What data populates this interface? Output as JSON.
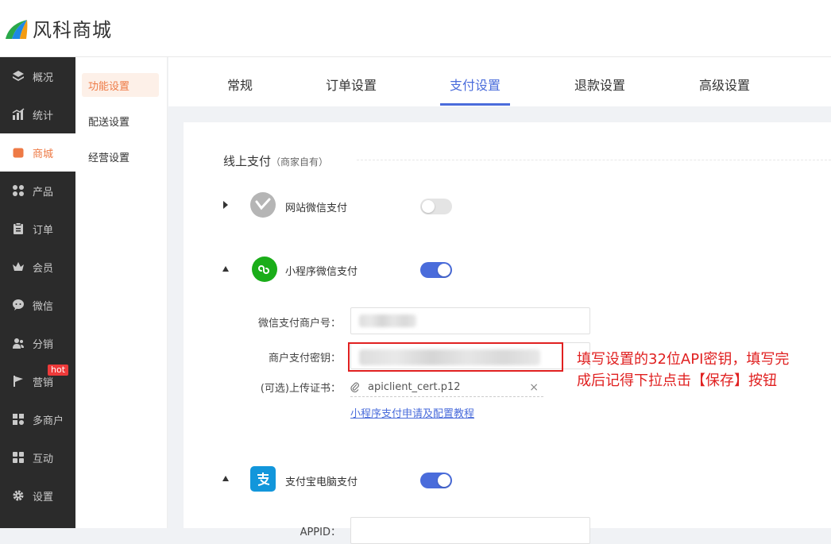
{
  "header": {
    "logo_text": "风科商城"
  },
  "sidebar": {
    "items": [
      {
        "label": "概况",
        "icon": "layers-icon"
      },
      {
        "label": "统计",
        "icon": "chart-icon"
      },
      {
        "label": "商城",
        "icon": "shop-icon",
        "active": true
      },
      {
        "label": "产品",
        "icon": "grid-icon"
      },
      {
        "label": "订单",
        "icon": "clipboard-icon"
      },
      {
        "label": "会员",
        "icon": "crown-icon"
      },
      {
        "label": "微信",
        "icon": "chat-icon"
      },
      {
        "label": "分销",
        "icon": "users-icon"
      },
      {
        "label": "营销",
        "icon": "flag-icon",
        "badge": "hot"
      },
      {
        "label": "多商户",
        "icon": "store-icon"
      },
      {
        "label": "互动",
        "icon": "blocks-icon"
      },
      {
        "label": "设置",
        "icon": "gear-icon"
      }
    ]
  },
  "subnav": {
    "items": [
      "功能设置",
      "配送设置",
      "经营设置"
    ]
  },
  "tabs": [
    "常规",
    "订单设置",
    "支付设置",
    "退款设置",
    "高级设置"
  ],
  "section": {
    "title": "线上支付",
    "subtitle": "（商家自有）"
  },
  "payments": {
    "web_wechat": {
      "label": "网站微信支付",
      "enabled": false
    },
    "mini_wechat": {
      "label": "小程序微信支付",
      "enabled": true
    },
    "alipay_pc": {
      "label": "支付宝电脑支付",
      "enabled": true
    }
  },
  "form": {
    "merchant_id_label": "微信支付商户号：",
    "merchant_key_label": "商户支付密钥：",
    "cert_label": "(可选)上传证书：",
    "cert_file": "apiclient_cert.p12",
    "tutorial_link": "小程序支付申请及配置教程",
    "appid_label": "APPID："
  },
  "annotation": {
    "line1": "填写设置的32位API密钥，填写完",
    "line2": "成后记得下拉点击【保存】按钮"
  },
  "colors": {
    "accent": "#4a6cdb",
    "brand": "#ee7a45",
    "annotation": "#e02020",
    "wechat": "#1aad19",
    "alipay": "#1296db"
  }
}
